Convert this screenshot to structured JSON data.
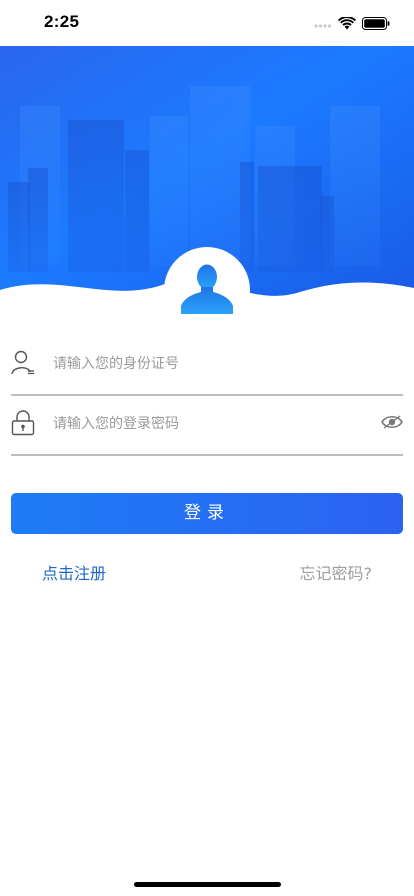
{
  "status_bar": {
    "time": "2:25",
    "icons": [
      "cellular-signal-icon",
      "wifi-icon",
      "battery-icon"
    ]
  },
  "header": {
    "gradient_start": "#2a6cf0",
    "gradient_end": "#1a5de9",
    "accent": "#1f80ff"
  },
  "avatar": {
    "icon": "user-silhouette-icon",
    "color": "#2196f3"
  },
  "form": {
    "id_number": {
      "placeholder": "请输入您的身份证号",
      "value": "",
      "icon": "user-icon"
    },
    "password": {
      "placeholder": "请输入您的登录密码",
      "value": "",
      "icon": "lock-icon",
      "toggle_icon": "eye-icon"
    }
  },
  "actions": {
    "login_label": "登录",
    "register_label": "点击注册",
    "forgot_label": "忘记密码?"
  }
}
